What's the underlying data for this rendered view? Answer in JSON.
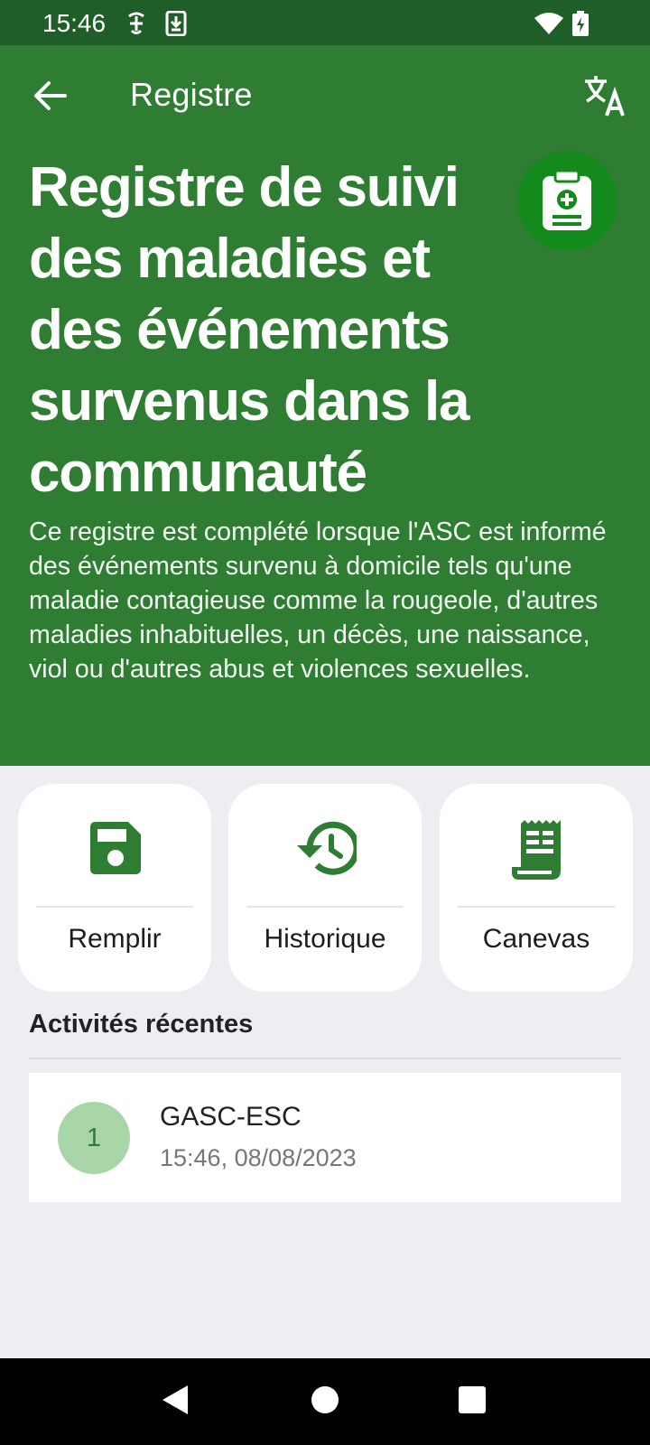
{
  "status_bar": {
    "time": "15:46",
    "icons": [
      "vpn-key-icon",
      "download-icon",
      "wifi-icon",
      "battery-charging-icon"
    ]
  },
  "header": {
    "title": "Registre",
    "back_icon": "arrow-left-icon",
    "translate_icon": "translate-icon",
    "form_title": "Registre de suivi des maladies et des événements survenus dans la communauté",
    "form_icon": "clipboard-medical-icon",
    "description": "Ce registre est complété lorsque l'ASC est informé des événements survenu à domicile tels qu'une maladie contagieuse comme la rougeole, d'autres maladies inhabituelles, un décès, une naissance, viol ou d'autres abus et violences sexuelles."
  },
  "actions": [
    {
      "label": "Remplir",
      "icon": "save-icon"
    },
    {
      "label": "Historique",
      "icon": "history-icon"
    },
    {
      "label": "Canevas",
      "icon": "form-template-icon"
    }
  ],
  "recent": {
    "title": "Activités récentes",
    "items": [
      {
        "badge": "1",
        "name": "GASC-ESC",
        "date": "15:46, 08/08/2023"
      }
    ]
  },
  "colors": {
    "primary": "#2e7d32",
    "status_bar": "#1f5e28",
    "badge_bg": "#a8d6a8",
    "background": "#eeedf2"
  }
}
